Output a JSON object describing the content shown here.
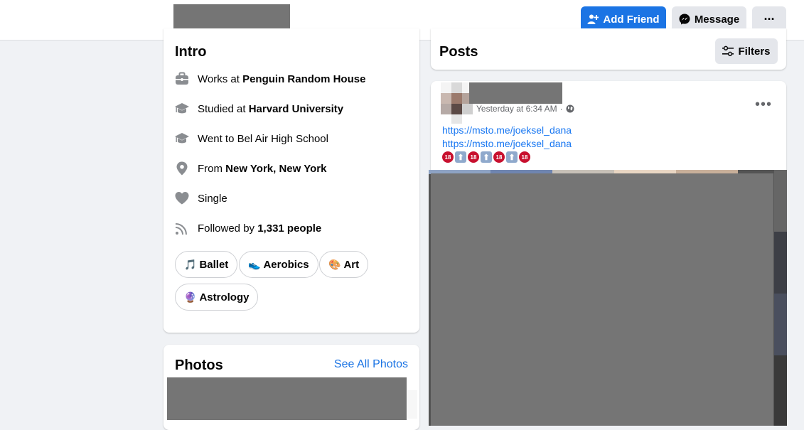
{
  "header": {
    "add_friend_label": "Add Friend",
    "message_label": "Message",
    "more_label": "···"
  },
  "intro": {
    "title": "Intro",
    "rows": [
      {
        "icon": "briefcase-icon",
        "prefix": "Works at ",
        "bold": "Penguin Random House"
      },
      {
        "icon": "graduation-cap-icon",
        "prefix": "Studied at ",
        "bold": "Harvard University"
      },
      {
        "icon": "graduation-cap-icon",
        "prefix": "Went to Bel Air High School",
        "bold": ""
      },
      {
        "icon": "location-pin-icon",
        "prefix": "From ",
        "bold": "New York, New York"
      },
      {
        "icon": "heart-icon",
        "prefix": "Single",
        "bold": ""
      },
      {
        "icon": "rss-feed-icon",
        "prefix": "Followed by ",
        "bold": "1,331 people"
      }
    ],
    "hobbies": [
      {
        "emoji": "🎵",
        "label": "Ballet"
      },
      {
        "emoji": "👟",
        "label": "Aerobics"
      },
      {
        "emoji": "🎨",
        "label": "Art"
      },
      {
        "emoji": "🔮",
        "label": "Astrology"
      }
    ]
  },
  "photos": {
    "title": "Photos",
    "see_all": "See All Photos"
  },
  "posts": {
    "title": "Posts",
    "filters_label": "Filters",
    "post": {
      "timestamp": "Yesterday at 6:34 AM",
      "separator": "·",
      "more": "•••",
      "links": [
        "https://msto.me/joeksel_dana",
        "https://msto.me/joeksel_dana"
      ],
      "emoji_sequence": [
        "🔞",
        "⬆",
        "🔞",
        "⬆",
        "🔞",
        "⬆",
        "🔞"
      ]
    }
  },
  "colors": {
    "accent": "#1b74e4",
    "link": "#1877f2",
    "background": "#f0f2f5",
    "redaction": "#757575"
  }
}
